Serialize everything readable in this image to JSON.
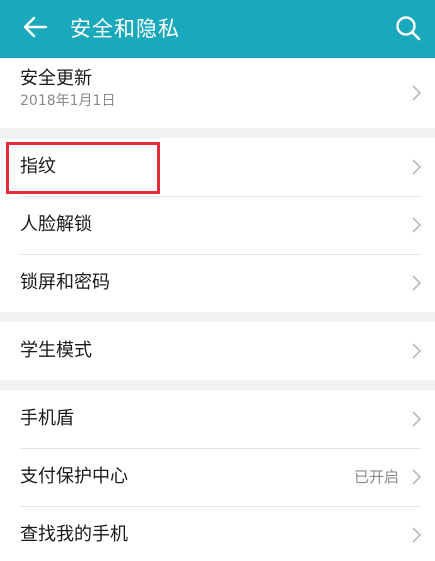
{
  "header": {
    "title": "安全和隐私",
    "back_icon": "back-arrow-icon",
    "search_icon": "search-icon",
    "background_color": "#1aa8bc"
  },
  "groups": [
    {
      "items": [
        {
          "label": "安全更新",
          "subtitle": "2018年1月1日"
        }
      ]
    },
    {
      "items": [
        {
          "label": "指纹"
        },
        {
          "label": "人脸解锁"
        },
        {
          "label": "锁屏和密码"
        }
      ]
    },
    {
      "items": [
        {
          "label": "学生模式"
        }
      ]
    },
    {
      "items": [
        {
          "label": "手机盾"
        },
        {
          "label": "支付保护中心",
          "value": "已开启"
        },
        {
          "label": "查找我的手机"
        }
      ]
    }
  ],
  "annotation": {
    "color": "#e52b36"
  }
}
